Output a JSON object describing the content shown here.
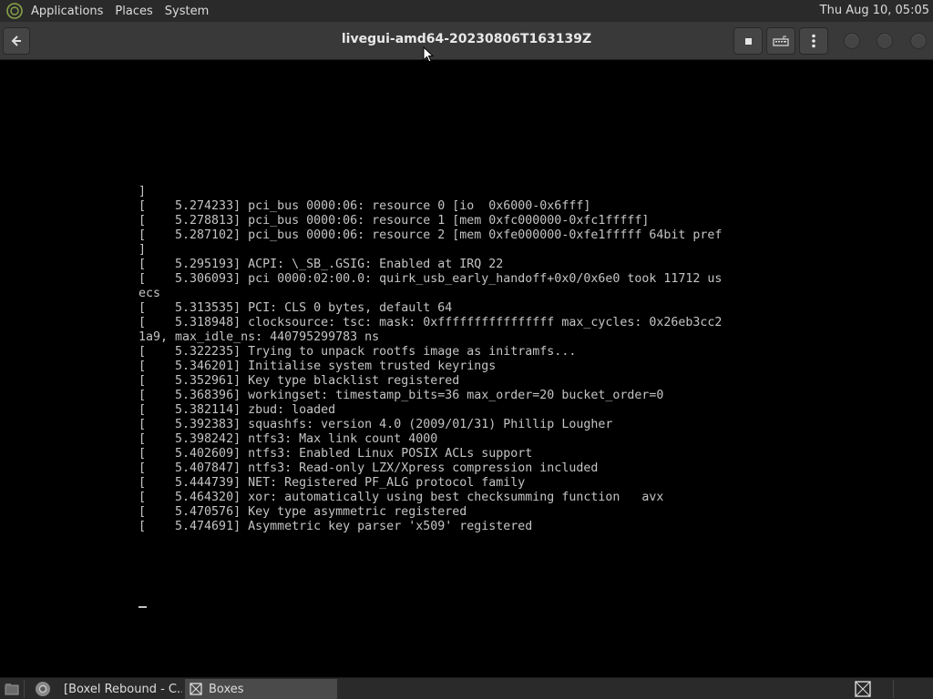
{
  "top_panel": {
    "menus": [
      "Applications",
      "Places",
      "System"
    ],
    "clock": "Thu Aug 10, 05:05"
  },
  "headerbar": {
    "title": "livegui-amd64-20230806T163139Z"
  },
  "console": {
    "lines": [
      "]",
      "[    5.274233] pci_bus 0000:06: resource 0 [io  0x6000-0x6fff]",
      "[    5.278813] pci_bus 0000:06: resource 1 [mem 0xfc000000-0xfc1fffff]",
      "[    5.287102] pci_bus 0000:06: resource 2 [mem 0xfe000000-0xfe1fffff 64bit pref",
      "]",
      "[    5.295193] ACPI: \\_SB_.GSIG: Enabled at IRQ 22",
      "[    5.306093] pci 0000:02:00.0: quirk_usb_early_handoff+0x0/0x6e0 took 11712 us",
      "ecs",
      "[    5.313535] PCI: CLS 0 bytes, default 64",
      "[    5.318948] clocksource: tsc: mask: 0xffffffffffffffff max_cycles: 0x26eb3cc2",
      "1a9, max_idle_ns: 440795299783 ns",
      "[    5.322235] Trying to unpack rootfs image as initramfs...",
      "[    5.346201] Initialise system trusted keyrings",
      "[    5.352961] Key type blacklist registered",
      "[    5.368396] workingset: timestamp_bits=36 max_order=20 bucket_order=0",
      "[    5.382114] zbud: loaded",
      "[    5.392383] squashfs: version 4.0 (2009/01/31) Phillip Lougher",
      "[    5.398242] ntfs3: Max link count 4000",
      "[    5.402609] ntfs3: Enabled Linux POSIX ACLs support",
      "[    5.407847] ntfs3: Read-only LZX/Xpress compression included",
      "[    5.444739] NET: Registered PF_ALG protocol family",
      "[    5.464320] xor: automatically using best checksumming function   avx",
      "[    5.470576] Key type asymmetric registered",
      "[    5.474691] Asymmetric key parser 'x509' registered"
    ]
  },
  "taskbar": {
    "tasks": [
      {
        "label": "[Boxel Rebound - C..."
      },
      {
        "label": "Boxes"
      }
    ]
  },
  "colors": {
    "panel_bg": "#2a2a2a",
    "headerbar_bg": "#393939",
    "console_bg": "#000000",
    "console_fg": "#c4c4c4"
  }
}
